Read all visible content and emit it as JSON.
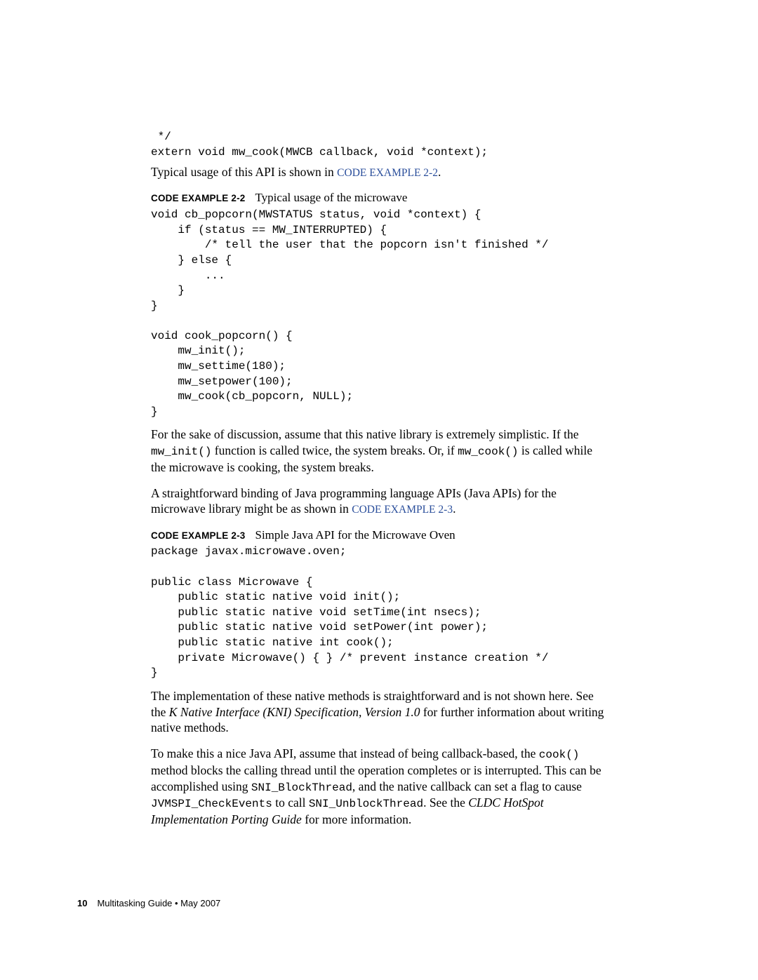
{
  "code_top": " */\nextern void mw_cook(MWCB callback, void *context);",
  "intro_1a": "Typical usage of this API is shown in ",
  "intro_1_link": "CODE EXAMPLE 2-2",
  "intro_1b": ".",
  "example22": {
    "label": "CODE EXAMPLE 2-2",
    "caption": "Typical usage of the microwave"
  },
  "code_ex22": "void cb_popcorn(MWSTATUS status, void *context) {\n    if (status == MW_INTERRUPTED) {\n        /* tell the user that the popcorn isn't finished */\n    } else {\n        ...\n    }\n}\n\nvoid cook_popcorn() {\n    mw_init();\n    mw_settime(180);\n    mw_setpower(100);\n    mw_cook(cb_popcorn, NULL);\n}",
  "para2_a": "For the sake of discussion, assume that this native library is extremely simplistic. If the ",
  "para2_m1": "mw_init()",
  "para2_b": " function is called twice, the system breaks. Or, if ",
  "para2_m2": "mw_cook()",
  "para2_c": " is called while the microwave is cooking, the system breaks.",
  "para3_a": "A straightforward binding of Java programming language APIs (Java APIs) for the microwave library might be as shown in ",
  "para3_link": "CODE EXAMPLE 2-3",
  "para3_b": ".",
  "example23": {
    "label": "CODE EXAMPLE 2-3",
    "caption": "Simple Java API for the Microwave Oven"
  },
  "code_ex23": "package javax.microwave.oven;\n\npublic class Microwave {\n    public static native void init();\n    public static native void setTime(int nsecs);\n    public static native void setPower(int power);\n    public static native int cook();\n    private Microwave() { } /* prevent instance creation */\n}",
  "para4_a": "The implementation of these native methods is straightforward and is not shown here. See the ",
  "para4_i": "K Native Interface (KNI) Specification, Version 1.0",
  "para4_b": " for further information about writing native methods.",
  "para5_a": "To make this a nice Java API, assume that instead of being callback-based, the ",
  "para5_m1": "cook()",
  "para5_b": " method blocks the calling thread until the operation completes or is interrupted. This can be accomplished using ",
  "para5_m2": "SNI_BlockThread",
  "para5_c": ", and the native callback can set a flag to cause ",
  "para5_m3": "JVMSPI_CheckEvents",
  "para5_d": " to call ",
  "para5_m4": "SNI_UnblockThread",
  "para5_e": ". See the ",
  "para5_i": "CLDC HotSpot Implementation Porting Guide",
  "para5_f": " for more information.",
  "footer": {
    "page": "10",
    "title": "Multitasking Guide  •  May 2007"
  }
}
